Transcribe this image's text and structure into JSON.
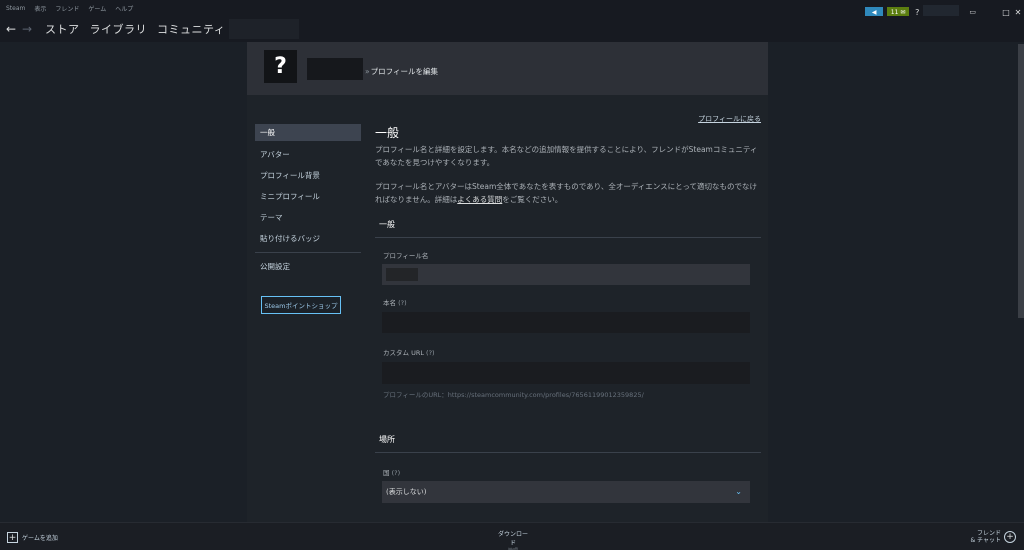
{
  "menubar": [
    "Steam",
    "表示",
    "フレンド",
    "ゲーム",
    "ヘルプ"
  ],
  "nav": {
    "back_icon": "←",
    "forward_icon": "→",
    "links": [
      "ストア",
      "ライブラリ",
      "コミュニティ"
    ]
  },
  "topright": {
    "notif_count": "11",
    "help": "?",
    "window_controls": [
      "_",
      "□",
      "✕"
    ]
  },
  "profile": {
    "avatar_glyph": "?",
    "edit_title": "プロフィールを編集",
    "back_link": "プロフィールに戻る"
  },
  "leftnav": {
    "items": [
      "一般",
      "アバター",
      "プロフィール背景",
      "ミニプロフィール",
      "テーマ",
      "貼り付けるバッジ"
    ],
    "privacy": "公開設定",
    "points_shop": "Steamポイントショップ"
  },
  "main": {
    "title": "一般",
    "desc1": "プロフィール名と詳細を設定します。本名などの追加情報を提供することにより、フレンドがSteamコミュニティであなたを見つけやすくなります。",
    "desc2_pre": "プロフィール名とアバターはSteam全体であなたを表すものであり、全オーディエンスにとって適切なものでなければなりません。詳細は",
    "desc2_link": "よくある質問",
    "desc2_post": "をご覧ください。",
    "general_head": "一般",
    "profile_name_label": "プロフィール名",
    "real_name_label": "本名",
    "custom_url_label": "カスタム URL",
    "q_mark": "(?)",
    "profile_url_hint": "プロフィールのURL：https://steamcommunity.com/profiles/76561199012359825/",
    "location_head": "場所",
    "country_label": "国",
    "country_value": "(表示しない)"
  },
  "bottombar": {
    "add_game": "ゲームを追加",
    "downloads": "ダウンロード",
    "downloads_sub": "管理",
    "friends_line1": "フレンド",
    "friends_line2": "& チャット"
  }
}
